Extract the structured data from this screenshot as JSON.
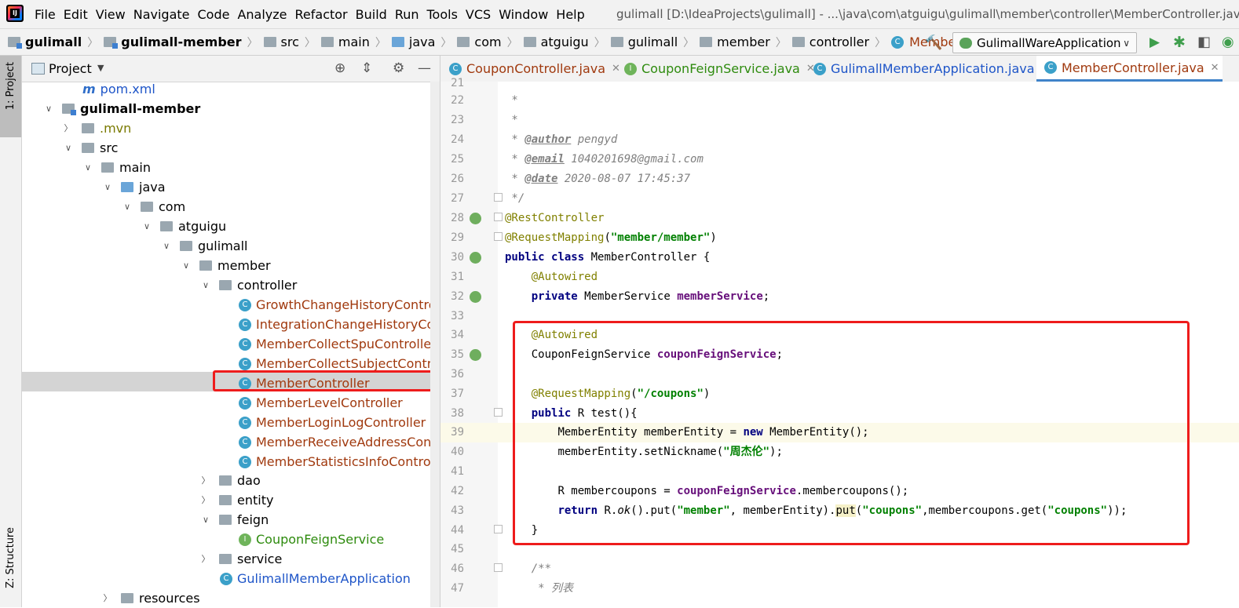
{
  "menubar": {
    "items": [
      "File",
      "Edit",
      "View",
      "Navigate",
      "Code",
      "Analyze",
      "Refactor",
      "Build",
      "Run",
      "Tools",
      "VCS",
      "Window",
      "Help"
    ],
    "window_title": "gulimall [D:\\IdeaProjects\\gulimall] - ...\\java\\com\\atguigu\\gulimall\\member\\controller\\MemberController.java"
  },
  "breadcrumb": [
    "gulimall",
    "gulimall-member",
    "src",
    "main",
    "java",
    "com",
    "atguigu",
    "gulimall",
    "member",
    "controller",
    "MemberController"
  ],
  "run_config": "GulimallWareApplication",
  "tool_windows": {
    "project": "1: Project",
    "structure": "Z: Structure"
  },
  "project_panel": {
    "title": "Project",
    "tree": [
      {
        "label": "pom.xml",
        "kind": "maven"
      },
      {
        "label": "gulimall-member",
        "kind": "module"
      },
      {
        "label": ".mvn",
        "kind": "folder"
      },
      {
        "label": "src",
        "kind": "folder"
      },
      {
        "label": "main",
        "kind": "folder"
      },
      {
        "label": "java",
        "kind": "folder"
      },
      {
        "label": "com",
        "kind": "package"
      },
      {
        "label": "atguigu",
        "kind": "package"
      },
      {
        "label": "gulimall",
        "kind": "package"
      },
      {
        "label": "member",
        "kind": "package"
      },
      {
        "label": "controller",
        "kind": "package"
      },
      {
        "label": "GrowthChangeHistoryController",
        "kind": "class"
      },
      {
        "label": "IntegrationChangeHistoryContro",
        "kind": "class"
      },
      {
        "label": "MemberCollectSpuController",
        "kind": "class"
      },
      {
        "label": "MemberCollectSubjectControlle",
        "kind": "class"
      },
      {
        "label": "MemberController",
        "kind": "class",
        "selected": true
      },
      {
        "label": "MemberLevelController",
        "kind": "class"
      },
      {
        "label": "MemberLoginLogController",
        "kind": "class"
      },
      {
        "label": "MemberReceiveAddressControl",
        "kind": "class"
      },
      {
        "label": "MemberStatisticsInfoController",
        "kind": "class"
      },
      {
        "label": "dao",
        "kind": "package"
      },
      {
        "label": "entity",
        "kind": "package"
      },
      {
        "label": "feign",
        "kind": "package"
      },
      {
        "label": "CouponFeignService",
        "kind": "interface"
      },
      {
        "label": "service",
        "kind": "package"
      },
      {
        "label": "GulimallMemberApplication",
        "kind": "app"
      },
      {
        "label": "resources",
        "kind": "folder"
      }
    ]
  },
  "tabs": [
    "CouponController.java",
    "CouponFeignService.java",
    "GulimallMemberApplication.java",
    "MemberController.java"
  ],
  "active_tab": "MemberController.java",
  "code": {
    "line_numbers": [
      "21",
      "22",
      "23",
      "24",
      "25",
      "26",
      "27",
      "28",
      "29",
      "30",
      "31",
      "32",
      "33",
      "34",
      "35",
      "36",
      "37",
      "38",
      "39",
      "40",
      "41",
      "42",
      "43",
      "44",
      "45",
      "46",
      "47"
    ],
    "comment_star": " *",
    "author_tag": "@author",
    "author": " pengyd",
    "email_tag": "@email",
    "email": " 1040201698@gmail.com",
    "date_tag": "@date",
    "date": " 2020-08-07 17:45:37",
    "comment_end": " */",
    "rest_controller": "@RestController",
    "request_mapping": "@RequestMapping",
    "mapping_path": "\"member/member\"",
    "kw_public": "public",
    "kw_class": "class",
    "kw_private": "private",
    "kw_new": "new",
    "kw_return": "return",
    "class_name": " MemberController {",
    "autowired": "@Autowired",
    "member_service_type": "MemberService ",
    "member_service_field": "memberService",
    "coupon_feign_type": "CouponFeignService ",
    "coupon_feign_field": "couponFeignService",
    "coupons_path": "\"/coupons\"",
    "test_sig": " R test(){",
    "entity_decl": "MemberEntity memberEntity = ",
    "entity_ctor": " MemberEntity();",
    "set_nickname": "memberEntity.setNickname(",
    "nickname": "\"周杰伦\"",
    "r_decl": "R ",
    "r_var": "membercoupons",
    "r_assign": " = ",
    "feign_call": ".membercoupons();",
    "r_ok": "R.",
    "ok": "ok",
    "put1": "().put(",
    "member_key": "\"member\"",
    "put1_rest": ", memberEntity).",
    "put2": "put",
    "coupons_key": "\"coupons\"",
    "get_call": ",membercoupons.get(",
    "close_all": "));",
    "close_brace": "}",
    "javadoc_open": "/**",
    "list_comment": " * 列表"
  }
}
